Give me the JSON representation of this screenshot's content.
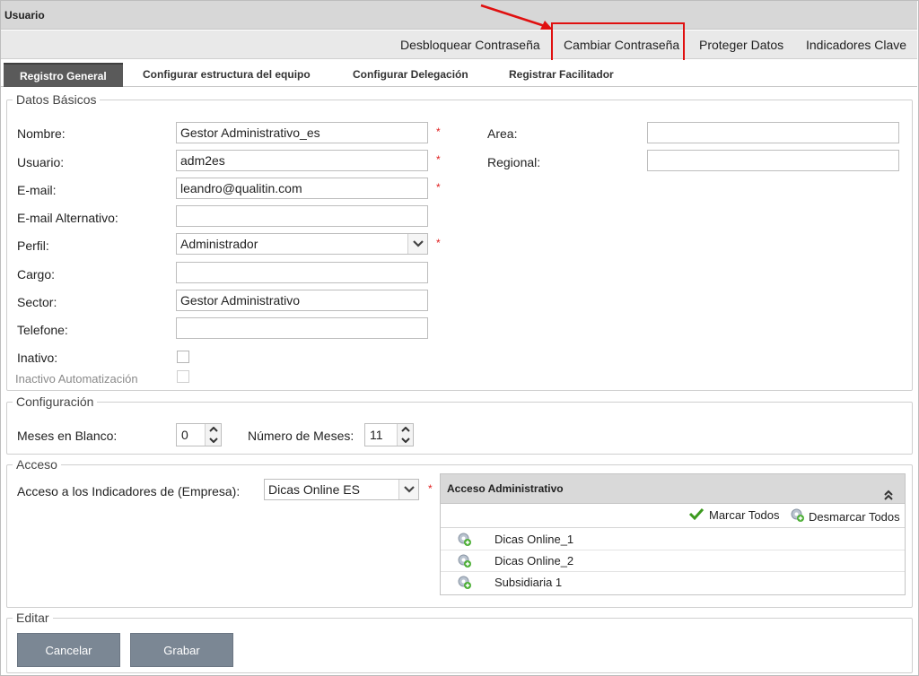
{
  "window": {
    "title": "Usuario"
  },
  "actions": [
    {
      "label": "Desbloquear Contraseña"
    },
    {
      "label": "Cambiar Contraseña"
    },
    {
      "label": "Proteger Datos"
    },
    {
      "label": "Indicadores Clave"
    }
  ],
  "tabs": [
    {
      "label": "Registro General",
      "active": true
    },
    {
      "label": "Configurar estructura del equipo"
    },
    {
      "label": "Configurar Delegación"
    },
    {
      "label": "Registrar Facilitador"
    }
  ],
  "datos_basicos": {
    "legend": "Datos Básicos",
    "nombre_label": "Nombre:",
    "nombre_value": "Gestor Administrativo_es",
    "usuario_label": "Usuario:",
    "usuario_value": "adm2es",
    "email_label": "E-mail:",
    "email_value": "leandro@qualitin.com",
    "email_alt_label": "E-mail Alternativo:",
    "email_alt_value": "",
    "perfil_label": "Perfil:",
    "perfil_value": "Administrador",
    "cargo_label": "Cargo:",
    "cargo_value": "",
    "sector_label": "Sector:",
    "sector_value": "Gestor Administrativo",
    "telefone_label": "Telefone:",
    "telefone_value": "",
    "inativo_label": "Inativo:",
    "inactivo_auto_label": "Inactivo Automatización",
    "area_label": "Area:",
    "area_value": "",
    "regional_label": "Regional:",
    "regional_value": "",
    "required_mark": "*"
  },
  "configuracion": {
    "legend": "Configuración",
    "meses_blanco_label": "Meses en Blanco:",
    "meses_blanco_value": "0",
    "numero_meses_label": "Número de Meses:",
    "numero_meses_value": "11"
  },
  "acceso": {
    "legend": "Acceso",
    "empresa_label": "Acceso a los Indicadores de (Empresa):",
    "empresa_value": "Dicas Online ES",
    "panel_title": "Acceso Administrativo",
    "marcar_todos": "Marcar Todos",
    "desmarcar_todos": "Desmarcar Todos",
    "items": [
      {
        "label": "Dicas Online_1"
      },
      {
        "label": "Dicas Online_2"
      },
      {
        "label": "Subsidiaria 1"
      }
    ]
  },
  "editar": {
    "legend": "Editar",
    "cancel_label": "Cancelar",
    "save_label": "Grabar"
  },
  "colors": {
    "required": "#e02020",
    "highlight": "#e01010",
    "active_tab": "#5a5a5a",
    "button": "#7b8794",
    "check_green": "#3c9a1e"
  }
}
